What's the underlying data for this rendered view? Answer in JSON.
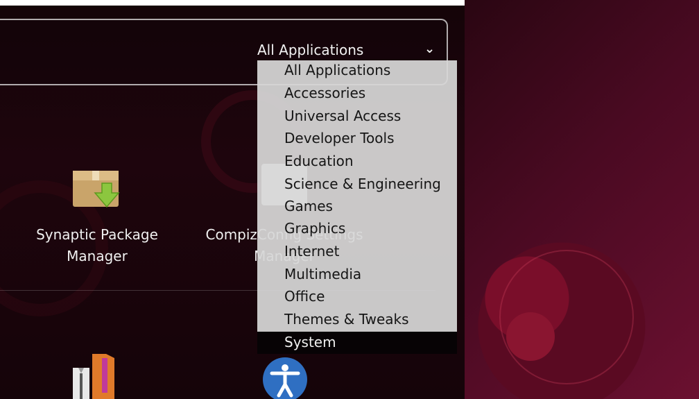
{
  "filter": {
    "selected": "All Applications",
    "chevron": "⌄"
  },
  "apps": [
    {
      "name_line1": "Synaptic Package",
      "name_line2": "Manager",
      "icon": "package-icon"
    },
    {
      "name_line1": "CompizConfig Settings",
      "name_line2": "Manager",
      "icon": "compizconfig-icon"
    },
    {
      "icon": "shirts-icon"
    },
    {
      "icon": "accessibility-icon"
    }
  ],
  "dropdown": {
    "options": [
      "All Applications",
      "Accessories",
      "Universal Access",
      "Developer Tools",
      "Education",
      "Science & Engineering",
      "Games",
      "Graphics",
      "Internet",
      "Multimedia",
      "Office",
      "Themes & Tweaks",
      "System"
    ]
  },
  "colors": {
    "dash_background": "#1a0509",
    "wallpaper_accent": "#6b1030",
    "dropdown_background": "#d7d7d7"
  }
}
